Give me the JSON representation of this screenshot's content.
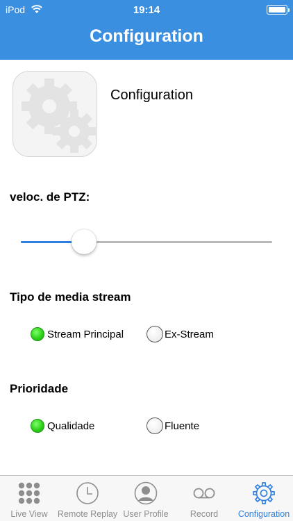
{
  "status_bar": {
    "carrier": "iPod",
    "time": "19:14"
  },
  "nav": {
    "title": "Configuration"
  },
  "header_block": {
    "title": "Configuration",
    "icon": "gears-icon"
  },
  "ptz_speed": {
    "label": "veloc. de PTZ:",
    "value_fraction": 0.25
  },
  "media_stream": {
    "label": "Tipo de media stream",
    "options": [
      {
        "label": "Stream Principal",
        "selected": true
      },
      {
        "label": "Ex-Stream",
        "selected": false
      }
    ]
  },
  "priority": {
    "label": "Prioridade",
    "options": [
      {
        "label": "Qualidade",
        "selected": true
      },
      {
        "label": "Fluente",
        "selected": false
      }
    ]
  },
  "tabs": [
    {
      "label": "Live View",
      "icon": "grid-icon",
      "active": false
    },
    {
      "label": "Remote Replay",
      "icon": "clock-icon",
      "active": false
    },
    {
      "label": "User Profile",
      "icon": "user-icon",
      "active": false
    },
    {
      "label": "Record",
      "icon": "voicemail-icon",
      "active": false
    },
    {
      "label": "Configuration",
      "icon": "gear-icon",
      "active": true
    }
  ],
  "colors": {
    "header_bg": "#3b8fe1",
    "accent": "#2f7fe0",
    "radio_on": "#2ed11b",
    "tab_inactive": "#8e8e8e"
  }
}
